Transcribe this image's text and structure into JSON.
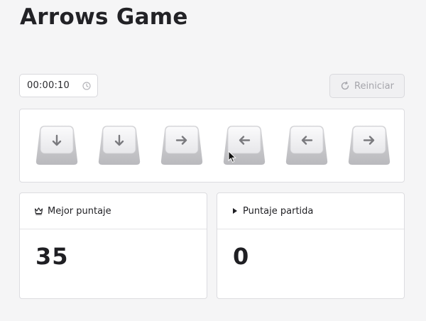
{
  "app": {
    "title": "Arrows Game"
  },
  "toolbar": {
    "timer_value": "00:00:10",
    "timer_icon": "clock-icon",
    "reset_label": "Reiniciar",
    "reset_icon": "rotate-icon"
  },
  "keys": [
    {
      "direction": "down"
    },
    {
      "direction": "down"
    },
    {
      "direction": "right"
    },
    {
      "direction": "left"
    },
    {
      "direction": "left"
    },
    {
      "direction": "right"
    }
  ],
  "scores": {
    "best": {
      "label": "Mejor puntaje",
      "icon": "crown-icon",
      "value": "35"
    },
    "current": {
      "label": "Puntaje partida",
      "icon": "play-icon",
      "value": "0"
    }
  },
  "colors": {
    "background": "#f5f5f6",
    "panel": "#ffffff",
    "border": "#dcdce0",
    "text": "#1f1f23",
    "disabled_text": "#a5a5ab",
    "key_arrow": "#7a7a7e"
  }
}
